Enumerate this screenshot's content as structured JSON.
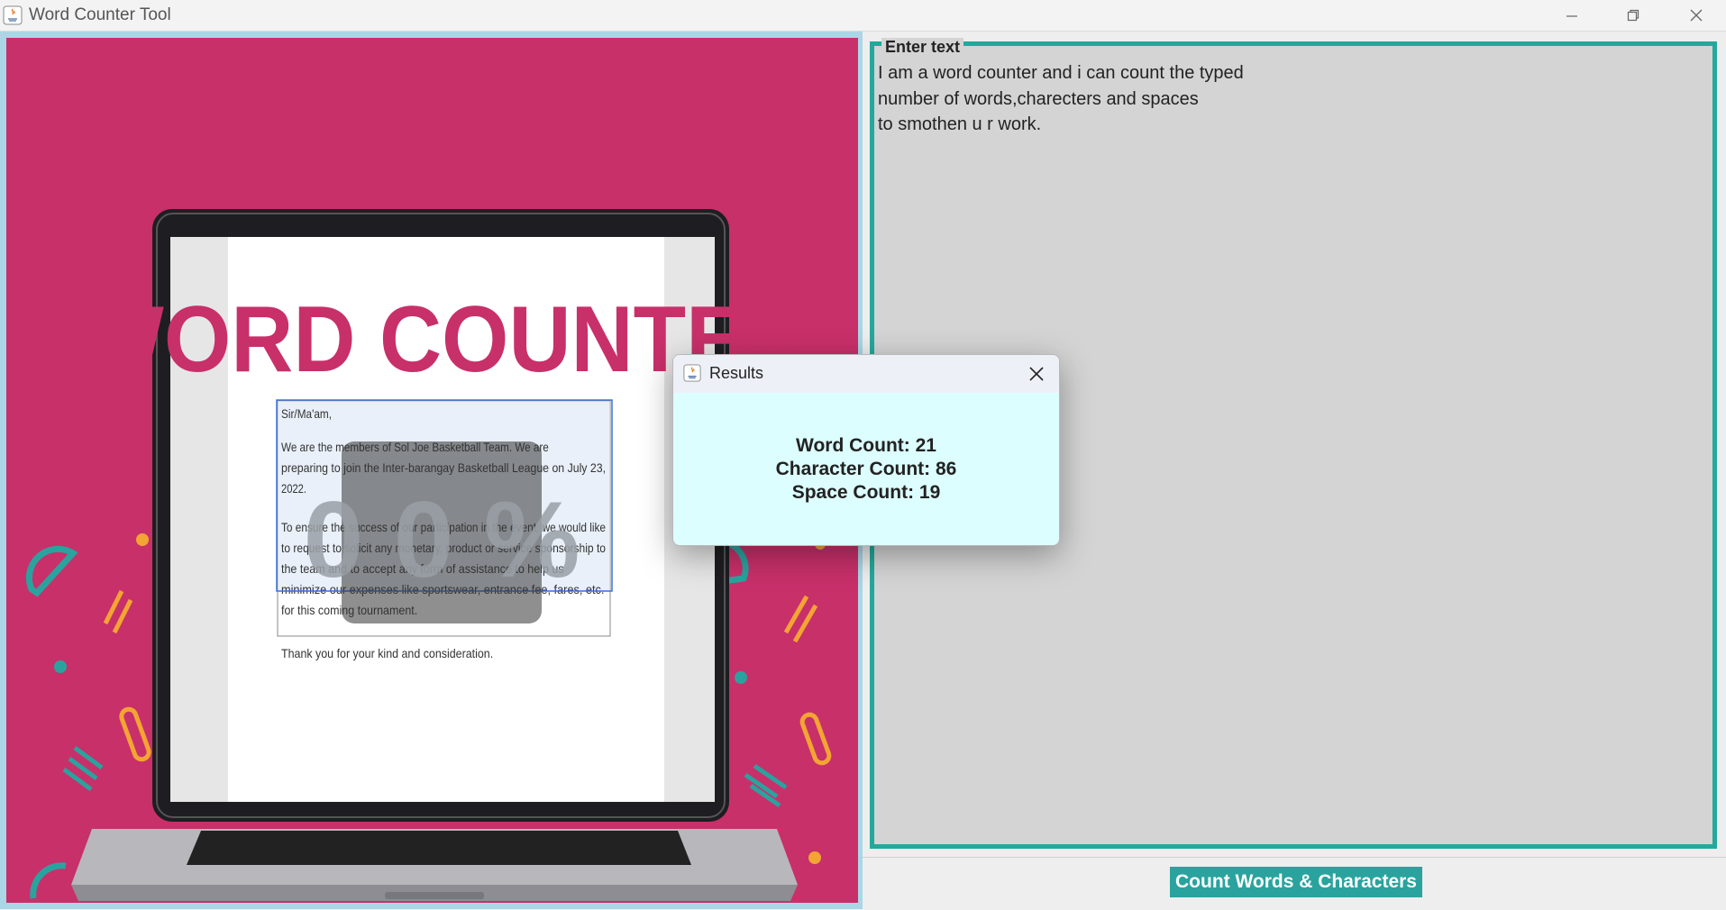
{
  "window": {
    "title": "Word Counter Tool"
  },
  "banner": {
    "heading": "WORD COUNTER",
    "doc_lines": [
      "Sir/Ma'am,",
      "We are the members of Sol Joe Basketball Team. We are",
      "preparing to join the Inter-barangay Basketball League on July 23,",
      "2022.",
      "To ensure the success of our participation in the event, we would like",
      "to request to solicit any monetary, product or service sponsorship to",
      "the team and to accept any form of assistance to help us",
      "minimize our expenses like sportswear, entrance fee, fares, etc.",
      "for this coming tournament.",
      "Thank you for your kind and consideration."
    ],
    "digits": "0 0 %"
  },
  "editor": {
    "legend": "Enter text",
    "text": "I am a word counter and i can count the typed\nnumber of words,charecters and spaces\nto smothen u r work."
  },
  "actions": {
    "count_label": "Count Words & Characters"
  },
  "dialog": {
    "title": "Results",
    "word_count": "Word Count: 21",
    "char_count": "Character Count: 86",
    "space_count": "Space Count: 19"
  },
  "colors": {
    "frame": "#a9d7e6",
    "banner_bg": "#c8306a",
    "accent_teal": "#23a99c",
    "dialog_bg": "#dcfeff"
  }
}
